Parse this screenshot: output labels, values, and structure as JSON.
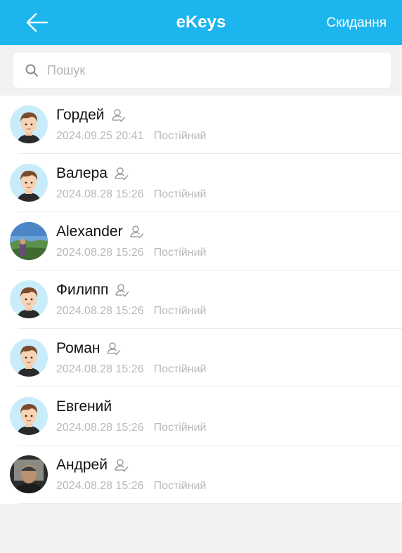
{
  "header": {
    "title": "eKeys",
    "reset_label": "Скидання",
    "back_icon": "arrow-left-icon",
    "background": "#1cb5ee"
  },
  "search": {
    "placeholder": "Пошук",
    "value": "",
    "icon": "search-icon"
  },
  "keys": [
    {
      "name": "Гордей",
      "date": "2024.09.25 20:41",
      "validity": "Постійний",
      "verified": true,
      "avatar": "cartoon"
    },
    {
      "name": "Валера",
      "date": "2024.08.28 15:26",
      "validity": "Постійний",
      "verified": true,
      "avatar": "cartoon"
    },
    {
      "name": "Alexander",
      "date": "2024.08.28 15:26",
      "validity": "Постійний",
      "verified": true,
      "avatar": "photo-landscape"
    },
    {
      "name": "Филипп",
      "date": "2024.08.28 15:26",
      "validity": "Постійний",
      "verified": true,
      "avatar": "cartoon"
    },
    {
      "name": "Роман",
      "date": "2024.08.28 15:26",
      "validity": "Постійний",
      "verified": true,
      "avatar": "cartoon"
    },
    {
      "name": "Евгений",
      "date": "2024.08.28 15:26",
      "validity": "Постійний",
      "verified": false,
      "avatar": "cartoon"
    },
    {
      "name": "Андрей",
      "date": "2024.08.28 15:26",
      "validity": "Постійний",
      "verified": true,
      "avatar": "photo-person"
    }
  ]
}
